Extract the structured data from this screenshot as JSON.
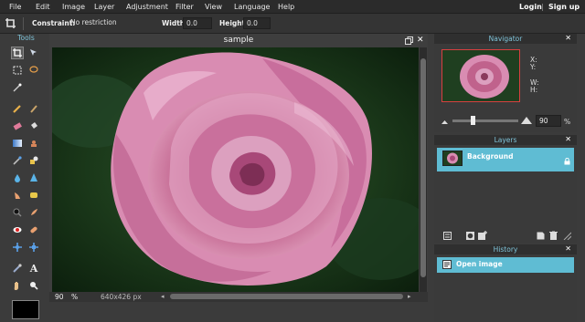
{
  "menu": {
    "items": [
      "File",
      "Edit",
      "Image",
      "Layer",
      "Adjustment",
      "Filter",
      "View",
      "Language",
      "Help"
    ],
    "login": "Login",
    "separator": "|",
    "signup": "Sign up"
  },
  "options": {
    "constraint_label": "Constraint:",
    "constraint_value": "No restriction",
    "width_label": "Width:",
    "width_value": "0.0",
    "height_label": "Height:",
    "height_value": "0.0"
  },
  "tools": {
    "title": "Tools"
  },
  "document": {
    "title": "sample",
    "zoom": "90",
    "zoom_unit": "%",
    "dimensions": "640x426 px"
  },
  "navigator": {
    "title": "Navigator",
    "x_label": "X:",
    "y_label": "Y:",
    "w_label": "W:",
    "h_label": "H:",
    "zoom_value": "90",
    "zoom_unit": "%",
    "zoom_level": 0.3
  },
  "layers": {
    "title": "Layers",
    "items": [
      {
        "name": "Background"
      }
    ]
  },
  "history": {
    "title": "History",
    "items": [
      {
        "name": "Open image"
      }
    ]
  },
  "colors": {
    "accent": "#5fbcd3",
    "panel_title": "#7ec3d9"
  }
}
